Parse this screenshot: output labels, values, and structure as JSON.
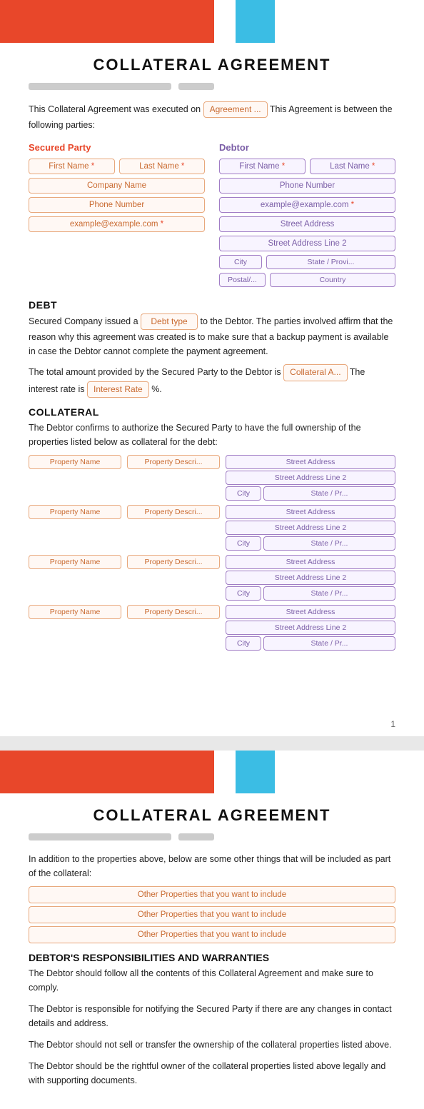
{
  "page1": {
    "header": {
      "title": "COLLATERAL AGREEMENT"
    },
    "intro": "This Collateral Agreement was executed on",
    "intro2": "This Agreement is between the following parties:",
    "agreement_field": "Agreement ...",
    "secured_party": {
      "label": "Secured Party",
      "first_name": "First Name",
      "last_name": "Last Name",
      "company_name": "Company Name",
      "phone_number": "Phone Number",
      "email": "example@example.com"
    },
    "debtor": {
      "label": "Debtor",
      "first_name": "First Name",
      "last_name": "Last Name",
      "phone_number": "Phone Number",
      "email": "example@example.com",
      "street_address": "Street Address",
      "street_address_2": "Street Address Line 2",
      "city": "City",
      "state": "State / Provi...",
      "postal": "Postal/...",
      "country": "Country"
    },
    "debt_section": {
      "title": "DEBT",
      "text1": "Secured Company issued a",
      "debt_type_field": "Debt type",
      "text2": "to the Debtor. The parties involved affirm that the reason why this agreement was created is to make sure that a backup payment is available in case the Debtor cannot complete the payment agreement.",
      "text3": "The total amount provided by the Secured Party to the Debtor is",
      "collateral_field": "Collateral A...",
      "text4": "The interest rate is",
      "interest_rate_field": "Interest Rate",
      "text5": "%."
    },
    "collateral_section": {
      "title": "COLLATERAL",
      "text": "The Debtor confirms to authorize the Secured Party to have the full ownership of the properties listed below as collateral for the debt:",
      "properties": [
        {
          "property_name": "Property Name",
          "property_desc": "Property Descri...",
          "street_address": "Street Address",
          "street_address_2": "Street Address Line 2",
          "city": "City",
          "state": "State / Pr..."
        },
        {
          "property_name": "Property Name",
          "property_desc": "Property Descri...",
          "street_address": "Street Address",
          "street_address_2": "Street Address Line 2",
          "city": "City",
          "state": "State / Pr..."
        },
        {
          "property_name": "Property Name",
          "property_desc": "Property Descri...",
          "street_address": "Street Address",
          "street_address_2": "Street Address Line 2",
          "city": "City",
          "state": "State / Pr..."
        },
        {
          "property_name": "Property Name",
          "property_desc": "Property Descri...",
          "street_address": "Street Address",
          "street_address_2": "Street Address Line 2",
          "city": "City",
          "state": "State / Pr..."
        }
      ]
    },
    "page_number": "1"
  },
  "page2": {
    "header": {
      "title": "COLLATERAL AGREEMENT"
    },
    "intro": "In addition to the properties above, below are some other things that will be included as part of the collateral:",
    "other_properties": [
      "Other Properties that you want to include",
      "Other Properties that you want to include",
      "Other Properties that you want to include"
    ],
    "responsibilities": {
      "title": "DEBTOR'S RESPONSIBILITIES AND WARRANTIES",
      "paragraphs": [
        "The Debtor should follow all the contents of this Collateral Agreement and make sure to comply.",
        "The Debtor is responsible for notifying the Secured Party if there are any changes in contact details and address.",
        "The Debtor should not sell or transfer the ownership of the collateral properties listed above.",
        "The Debtor should be the rightful owner of the collateral properties listed above legally and with supporting documents."
      ]
    }
  }
}
